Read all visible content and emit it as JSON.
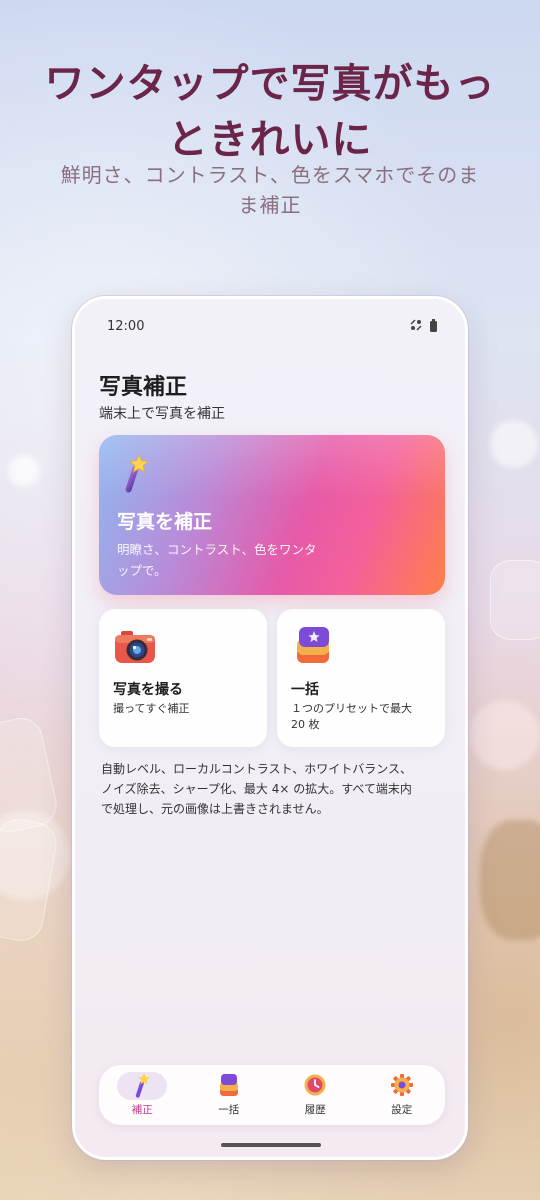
{
  "promo": {
    "headline_line1": "ワンタップで写真がもっ",
    "headline_line2": "ときれいに",
    "sub_line1": "鮮明さ、コントラスト、色をスマホでそのま",
    "sub_line2": "ま補正"
  },
  "status_bar": {
    "time": "12:00"
  },
  "app": {
    "title": "写真補正",
    "subtitle": "端末上で写真を補正"
  },
  "hero": {
    "icon": "magic-wand-icon",
    "title": "写真を補正",
    "desc_line1": "明瞭さ、コントラスト、色をワンタ",
    "desc_line2": "ップで。"
  },
  "cards": [
    {
      "icon": "camera-icon",
      "title": "写真を撮る",
      "desc": "撮ってすぐ補正"
    },
    {
      "icon": "batch-stack-icon",
      "title": "一括",
      "desc_line1": "１つのプリセットで最大",
      "desc_line2": "20 枚"
    }
  ],
  "info": {
    "line1": "自動レベル、ローカルコントラスト、ホワイトバランス、",
    "line2": "ノイズ除去、シャープ化、最大 4× の拡大。すべて端末内",
    "line3": "で処理し、元の画像は上書きされません。"
  },
  "nav": {
    "active_index": 0,
    "items": [
      {
        "label": "補正",
        "icon": "magic-wand-icon"
      },
      {
        "label": "一括",
        "icon": "batch-stack-icon"
      },
      {
        "label": "履歴",
        "icon": "history-clock-icon"
      },
      {
        "label": "設定",
        "icon": "gear-icon"
      }
    ]
  },
  "colors": {
    "headline": "#6b2548",
    "nav_active": "#c2388c"
  }
}
